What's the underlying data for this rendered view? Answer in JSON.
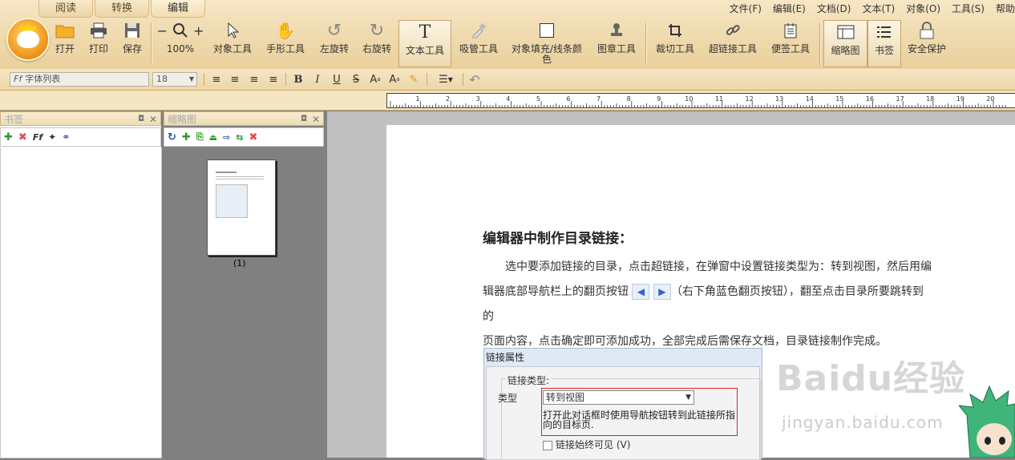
{
  "tabs": [
    "阅读",
    "转换",
    "编辑"
  ],
  "menu": [
    "文件(F)",
    "编辑(E)",
    "文档(D)",
    "文本(T)",
    "对象(O)",
    "工具(S)",
    "帮助"
  ],
  "toolbar": {
    "open": "打开",
    "print": "打印",
    "save": "保存",
    "zoom": "100%",
    "object_tool": "对象工具",
    "hand_tool": "手形工具",
    "rotate_left": "左旋转",
    "rotate_right": "右旋转",
    "text_tool": "文本工具",
    "dropper_tool": "吸管工具",
    "fill_tool": "对象填充/线条颜色",
    "stamp_tool": "图章工具",
    "crop_tool": "裁切工具",
    "link_tool": "超链接工具",
    "note_tool": "便签工具",
    "thumbnail": "缩略图",
    "bookmark": "书签",
    "security": "安全保护"
  },
  "format": {
    "font_placeholder": "字体列表",
    "font_size": "18"
  },
  "ruler_ticks": [
    "1",
    "2",
    "3",
    "4",
    "5",
    "6",
    "7",
    "8",
    "9",
    "10",
    "11",
    "12",
    "13",
    "14",
    "15",
    "16",
    "17",
    "18",
    "19",
    "20"
  ],
  "panels": {
    "bookmark_title": "书签",
    "thumbnail_title": "缩略图",
    "thumb_label": "(1)"
  },
  "doc": {
    "title": "编辑器中制作目录链接：",
    "line1": "选中要添加链接的目录，点击超链接，在弹窗中设置链接类型为：转到视图，然后用编",
    "line2_a": "辑器底部导航栏上的翻页按钮",
    "line2_b": "（右下角蓝色翻页按钮），翻至点击目录所要跳转到的",
    "line3": "页面内容，点击确定即可添加成功，全部完成后需保存文档，目录链接制作完成。"
  },
  "dialog": {
    "title": "链接属性",
    "group_label": "链接类型:",
    "type_label": "类型",
    "type_value": "转到视图",
    "description": "打开此对话框时使用导航按钮转到此链接所指向的目标页.",
    "checkbox_label": "链接始终可见 (V)"
  },
  "watermark": {
    "brand": "Baidu经验",
    "url": "jingyan.baidu.com"
  },
  "colors": {
    "accent": "#f29a1e",
    "ribbon": "#f1ddb3",
    "link_blue": "#2f66c9",
    "highlight_red": "#d22222"
  }
}
